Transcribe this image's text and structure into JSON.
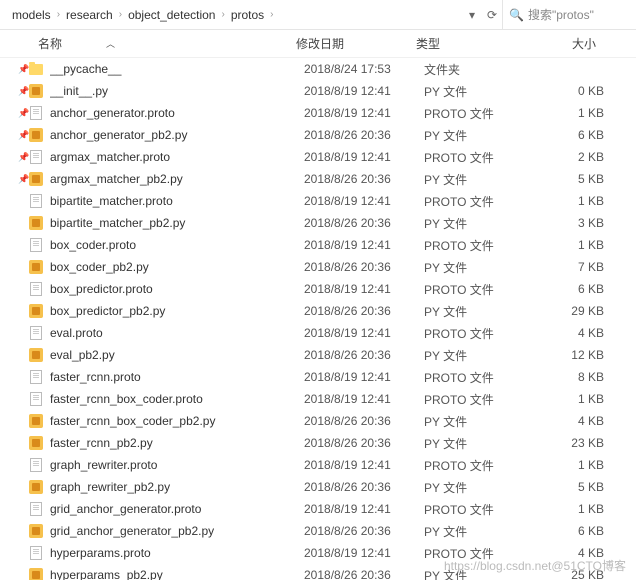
{
  "breadcrumb": [
    "models",
    "research",
    "object_detection",
    "protos"
  ],
  "search": {
    "placeholder": "搜索\"protos\""
  },
  "columns": {
    "name": "名称",
    "date": "修改日期",
    "type": "类型",
    "size": "大小"
  },
  "watermark": "https://blog.csdn.net@51CTO博客",
  "files": [
    {
      "name": "__pycache__",
      "date": "2018/8/24 17:53",
      "type": "文件夹",
      "size": "",
      "icon": "folder",
      "pin": true
    },
    {
      "name": "__init__.py",
      "date": "2018/8/19 12:41",
      "type": "PY 文件",
      "size": "0 KB",
      "icon": "py",
      "pin": true
    },
    {
      "name": "anchor_generator.proto",
      "date": "2018/8/19 12:41",
      "type": "PROTO 文件",
      "size": "1 KB",
      "icon": "proto",
      "pin": true
    },
    {
      "name": "anchor_generator_pb2.py",
      "date": "2018/8/26 20:36",
      "type": "PY 文件",
      "size": "6 KB",
      "icon": "py",
      "pin": true
    },
    {
      "name": "argmax_matcher.proto",
      "date": "2018/8/19 12:41",
      "type": "PROTO 文件",
      "size": "2 KB",
      "icon": "proto",
      "pin": true
    },
    {
      "name": "argmax_matcher_pb2.py",
      "date": "2018/8/26 20:36",
      "type": "PY 文件",
      "size": "5 KB",
      "icon": "py",
      "pin": true
    },
    {
      "name": "bipartite_matcher.proto",
      "date": "2018/8/19 12:41",
      "type": "PROTO 文件",
      "size": "1 KB",
      "icon": "proto",
      "pin": false
    },
    {
      "name": "bipartite_matcher_pb2.py",
      "date": "2018/8/26 20:36",
      "type": "PY 文件",
      "size": "3 KB",
      "icon": "py",
      "pin": false
    },
    {
      "name": "box_coder.proto",
      "date": "2018/8/19 12:41",
      "type": "PROTO 文件",
      "size": "1 KB",
      "icon": "proto",
      "pin": false
    },
    {
      "name": "box_coder_pb2.py",
      "date": "2018/8/26 20:36",
      "type": "PY 文件",
      "size": "7 KB",
      "icon": "py",
      "pin": false
    },
    {
      "name": "box_predictor.proto",
      "date": "2018/8/19 12:41",
      "type": "PROTO 文件",
      "size": "6 KB",
      "icon": "proto",
      "pin": false
    },
    {
      "name": "box_predictor_pb2.py",
      "date": "2018/8/26 20:36",
      "type": "PY 文件",
      "size": "29 KB",
      "icon": "py",
      "pin": false
    },
    {
      "name": "eval.proto",
      "date": "2018/8/19 12:41",
      "type": "PROTO 文件",
      "size": "4 KB",
      "icon": "proto",
      "pin": false
    },
    {
      "name": "eval_pb2.py",
      "date": "2018/8/26 20:36",
      "type": "PY 文件",
      "size": "12 KB",
      "icon": "py",
      "pin": false
    },
    {
      "name": "faster_rcnn.proto",
      "date": "2018/8/19 12:41",
      "type": "PROTO 文件",
      "size": "8 KB",
      "icon": "proto",
      "pin": false
    },
    {
      "name": "faster_rcnn_box_coder.proto",
      "date": "2018/8/19 12:41",
      "type": "PROTO 文件",
      "size": "1 KB",
      "icon": "proto",
      "pin": false
    },
    {
      "name": "faster_rcnn_box_coder_pb2.py",
      "date": "2018/8/26 20:36",
      "type": "PY 文件",
      "size": "4 KB",
      "icon": "py",
      "pin": false
    },
    {
      "name": "faster_rcnn_pb2.py",
      "date": "2018/8/26 20:36",
      "type": "PY 文件",
      "size": "23 KB",
      "icon": "py",
      "pin": false
    },
    {
      "name": "graph_rewriter.proto",
      "date": "2018/8/19 12:41",
      "type": "PROTO 文件",
      "size": "1 KB",
      "icon": "proto",
      "pin": false
    },
    {
      "name": "graph_rewriter_pb2.py",
      "date": "2018/8/26 20:36",
      "type": "PY 文件",
      "size": "5 KB",
      "icon": "py",
      "pin": false
    },
    {
      "name": "grid_anchor_generator.proto",
      "date": "2018/8/19 12:41",
      "type": "PROTO 文件",
      "size": "1 KB",
      "icon": "proto",
      "pin": false
    },
    {
      "name": "grid_anchor_generator_pb2.py",
      "date": "2018/8/26 20:36",
      "type": "PY 文件",
      "size": "6 KB",
      "icon": "py",
      "pin": false
    },
    {
      "name": "hyperparams.proto",
      "date": "2018/8/19 12:41",
      "type": "PROTO 文件",
      "size": "4 KB",
      "icon": "proto",
      "pin": false
    },
    {
      "name": "hyperparams_pb2.py",
      "date": "2018/8/26 20:36",
      "type": "PY 文件",
      "size": "25 KB",
      "icon": "py",
      "pin": false
    }
  ]
}
